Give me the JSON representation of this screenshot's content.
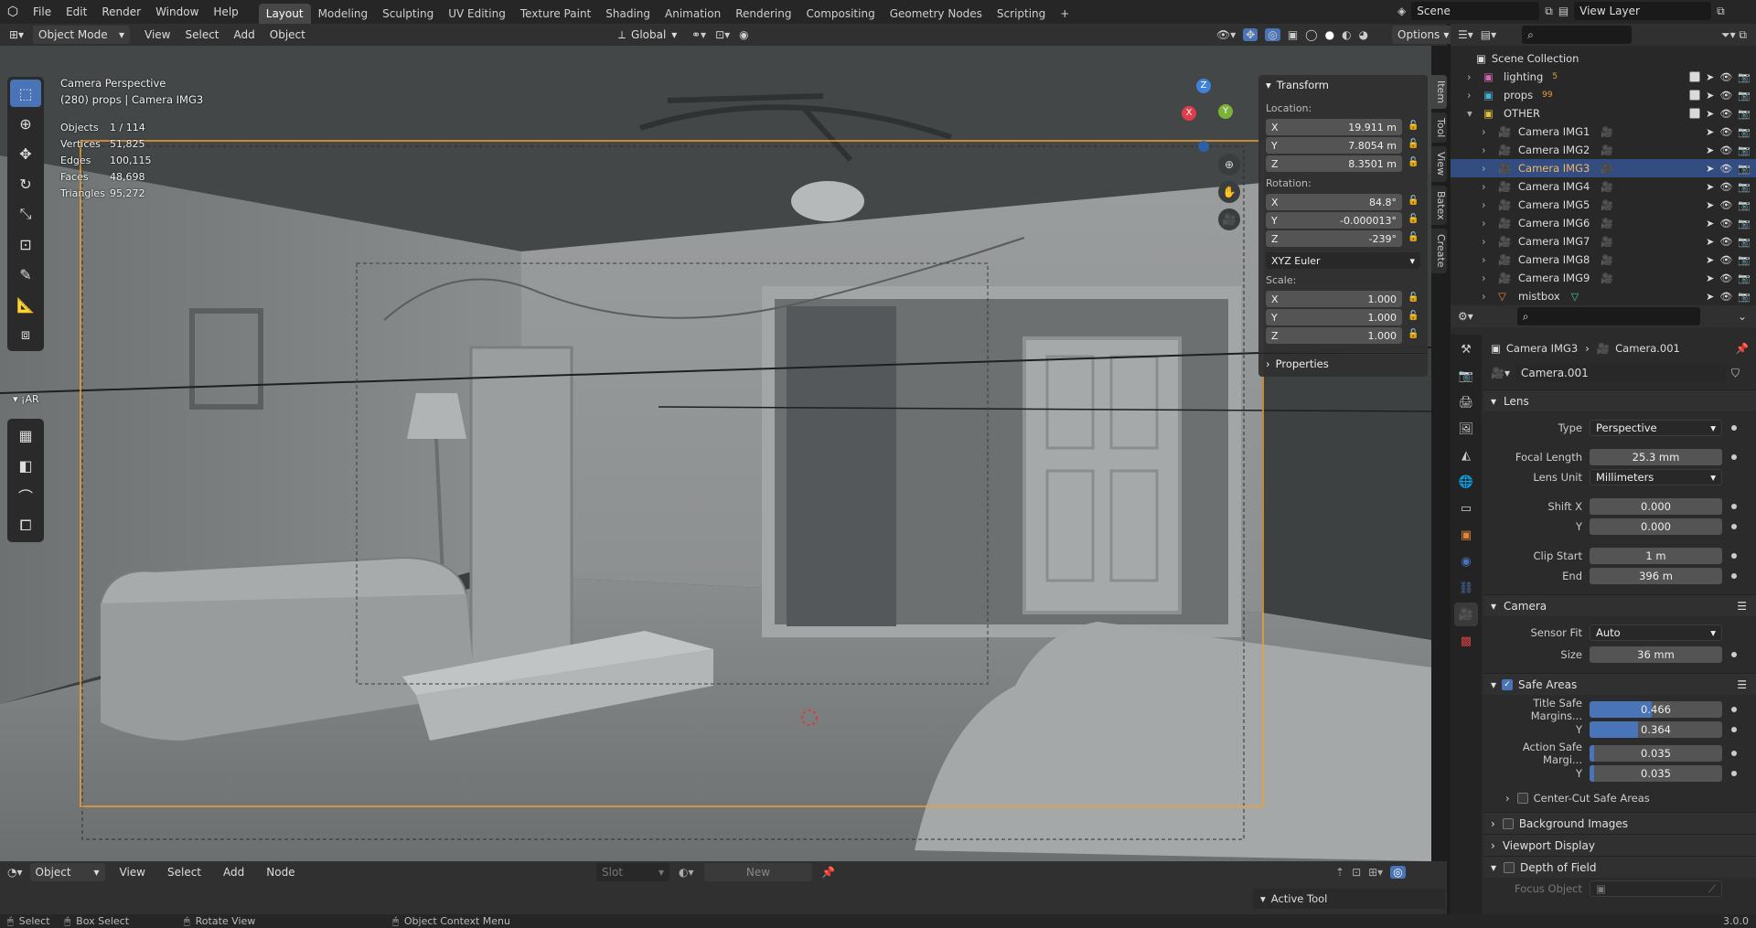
{
  "menu": {
    "items": [
      "File",
      "Edit",
      "Render",
      "Window",
      "Help"
    ]
  },
  "workspaces": [
    "Layout",
    "Modeling",
    "Sculpting",
    "UV Editing",
    "Texture Paint",
    "Shading",
    "Animation",
    "Rendering",
    "Compositing",
    "Geometry Nodes",
    "Scripting",
    "+"
  ],
  "scene": {
    "name": "Scene",
    "view_layer": "View Layer"
  },
  "viewport_header": {
    "mode": "Object Mode",
    "menus": [
      "View",
      "Select",
      "Add",
      "Object"
    ],
    "orientation": "Global",
    "options": "Options"
  },
  "overlay": {
    "title": "Camera Perspective",
    "subtitle": "(280) props | Camera IMG3",
    "stats": [
      {
        "k": "Objects",
        "v": "1 / 114"
      },
      {
        "k": "Vertices",
        "v": "51,825"
      },
      {
        "k": "Edges",
        "v": "100,115"
      },
      {
        "k": "Faces",
        "v": "48,698"
      },
      {
        "k": "Triangles",
        "v": "95,272"
      }
    ]
  },
  "axis": {
    "x": "X",
    "y": "Y",
    "z": "Z"
  },
  "npanel": {
    "title": "Transform",
    "location_label": "Location:",
    "location": [
      {
        "axis": "X",
        "value": "19.911 m"
      },
      {
        "axis": "Y",
        "value": "7.8054 m"
      },
      {
        "axis": "Z",
        "value": "8.3501 m"
      }
    ],
    "rotation_label": "Rotation:",
    "rotation": [
      {
        "axis": "X",
        "value": "84.8°"
      },
      {
        "axis": "Y",
        "value": "-0.000013°"
      },
      {
        "axis": "Z",
        "value": "-239°"
      }
    ],
    "rotation_mode": "XYZ Euler",
    "scale_label": "Scale:",
    "scale": [
      {
        "axis": "X",
        "value": "1.000"
      },
      {
        "axis": "Y",
        "value": "1.000"
      },
      {
        "axis": "Z",
        "value": "1.000"
      }
    ],
    "properties": "Properties",
    "tabs": [
      "Item",
      "Tool",
      "View",
      "Batex",
      "Create"
    ]
  },
  "collapsed_label": "¡AR",
  "timeline": {
    "editor": "Object",
    "menus": [
      "View",
      "Select",
      "Add",
      "Node"
    ],
    "slot": "Slot",
    "new": "New",
    "active_tool": "Active Tool"
  },
  "status": {
    "select": "Select",
    "box_select": "Box Select",
    "rotate": "Rotate View",
    "context": "Object Context Menu",
    "version": "3.0.0"
  },
  "outliner": {
    "root": "Scene Collection",
    "items": [
      {
        "name": "lighting",
        "type": "collection",
        "badge": "5"
      },
      {
        "name": "props",
        "type": "collection",
        "badge": "99"
      },
      {
        "name": "OTHER",
        "type": "collection"
      },
      {
        "name": "Camera IMG1",
        "type": "camera"
      },
      {
        "name": "Camera IMG2",
        "type": "camera"
      },
      {
        "name": "Camera IMG3",
        "type": "camera",
        "selected": true
      },
      {
        "name": "Camera IMG4",
        "type": "camera"
      },
      {
        "name": "Camera IMG5",
        "type": "camera"
      },
      {
        "name": "Camera IMG6",
        "type": "camera"
      },
      {
        "name": "Camera IMG7",
        "type": "camera"
      },
      {
        "name": "Camera IMG8",
        "type": "camera"
      },
      {
        "name": "Camera IMG9",
        "type": "camera"
      },
      {
        "name": "mistbox",
        "type": "mesh"
      }
    ]
  },
  "properties": {
    "breadcrumb_obj": "Camera IMG3",
    "breadcrumb_data": "Camera.001",
    "datablock": "Camera.001",
    "lens": {
      "title": "Lens",
      "type_label": "Type",
      "type": "Perspective",
      "focal_label": "Focal Length",
      "focal": "25.3 mm",
      "unit_label": "Lens Unit",
      "unit": "Millimeters",
      "shiftx_label": "Shift X",
      "shiftx": "0.000",
      "shifty_label": "Y",
      "shifty": "0.000",
      "clipstart_label": "Clip Start",
      "clipstart": "1 m",
      "clipend_label": "End",
      "clipend": "396 m"
    },
    "camera": {
      "title": "Camera",
      "fit_label": "Sensor Fit",
      "fit": "Auto",
      "size_label": "Size",
      "size": "36 mm"
    },
    "safe": {
      "title": "Safe Areas",
      "title_x_label": "Title Safe Margins...",
      "title_x": "0.466",
      "title_x_fill": 0.466,
      "title_y_label": "Y",
      "title_y": "0.364",
      "title_y_fill": 0.364,
      "action_x_label": "Action Safe Margi...",
      "action_x": "0.035",
      "action_x_fill": 0.035,
      "action_y_label": "Y",
      "action_y": "0.035",
      "action_y_fill": 0.035,
      "center": "Center-Cut Safe Areas"
    },
    "bg": "Background Images",
    "vd": "Viewport Display",
    "dof": "Depth of Field",
    "focus": "Focus Object"
  },
  "colors": {
    "accent": "#4a74b8",
    "camera_icon": "#e0863c",
    "selected_row": "#334d80",
    "x_axis": "#e03c4c",
    "y_axis": "#7bb33a",
    "z_axis": "#3f82d8"
  }
}
